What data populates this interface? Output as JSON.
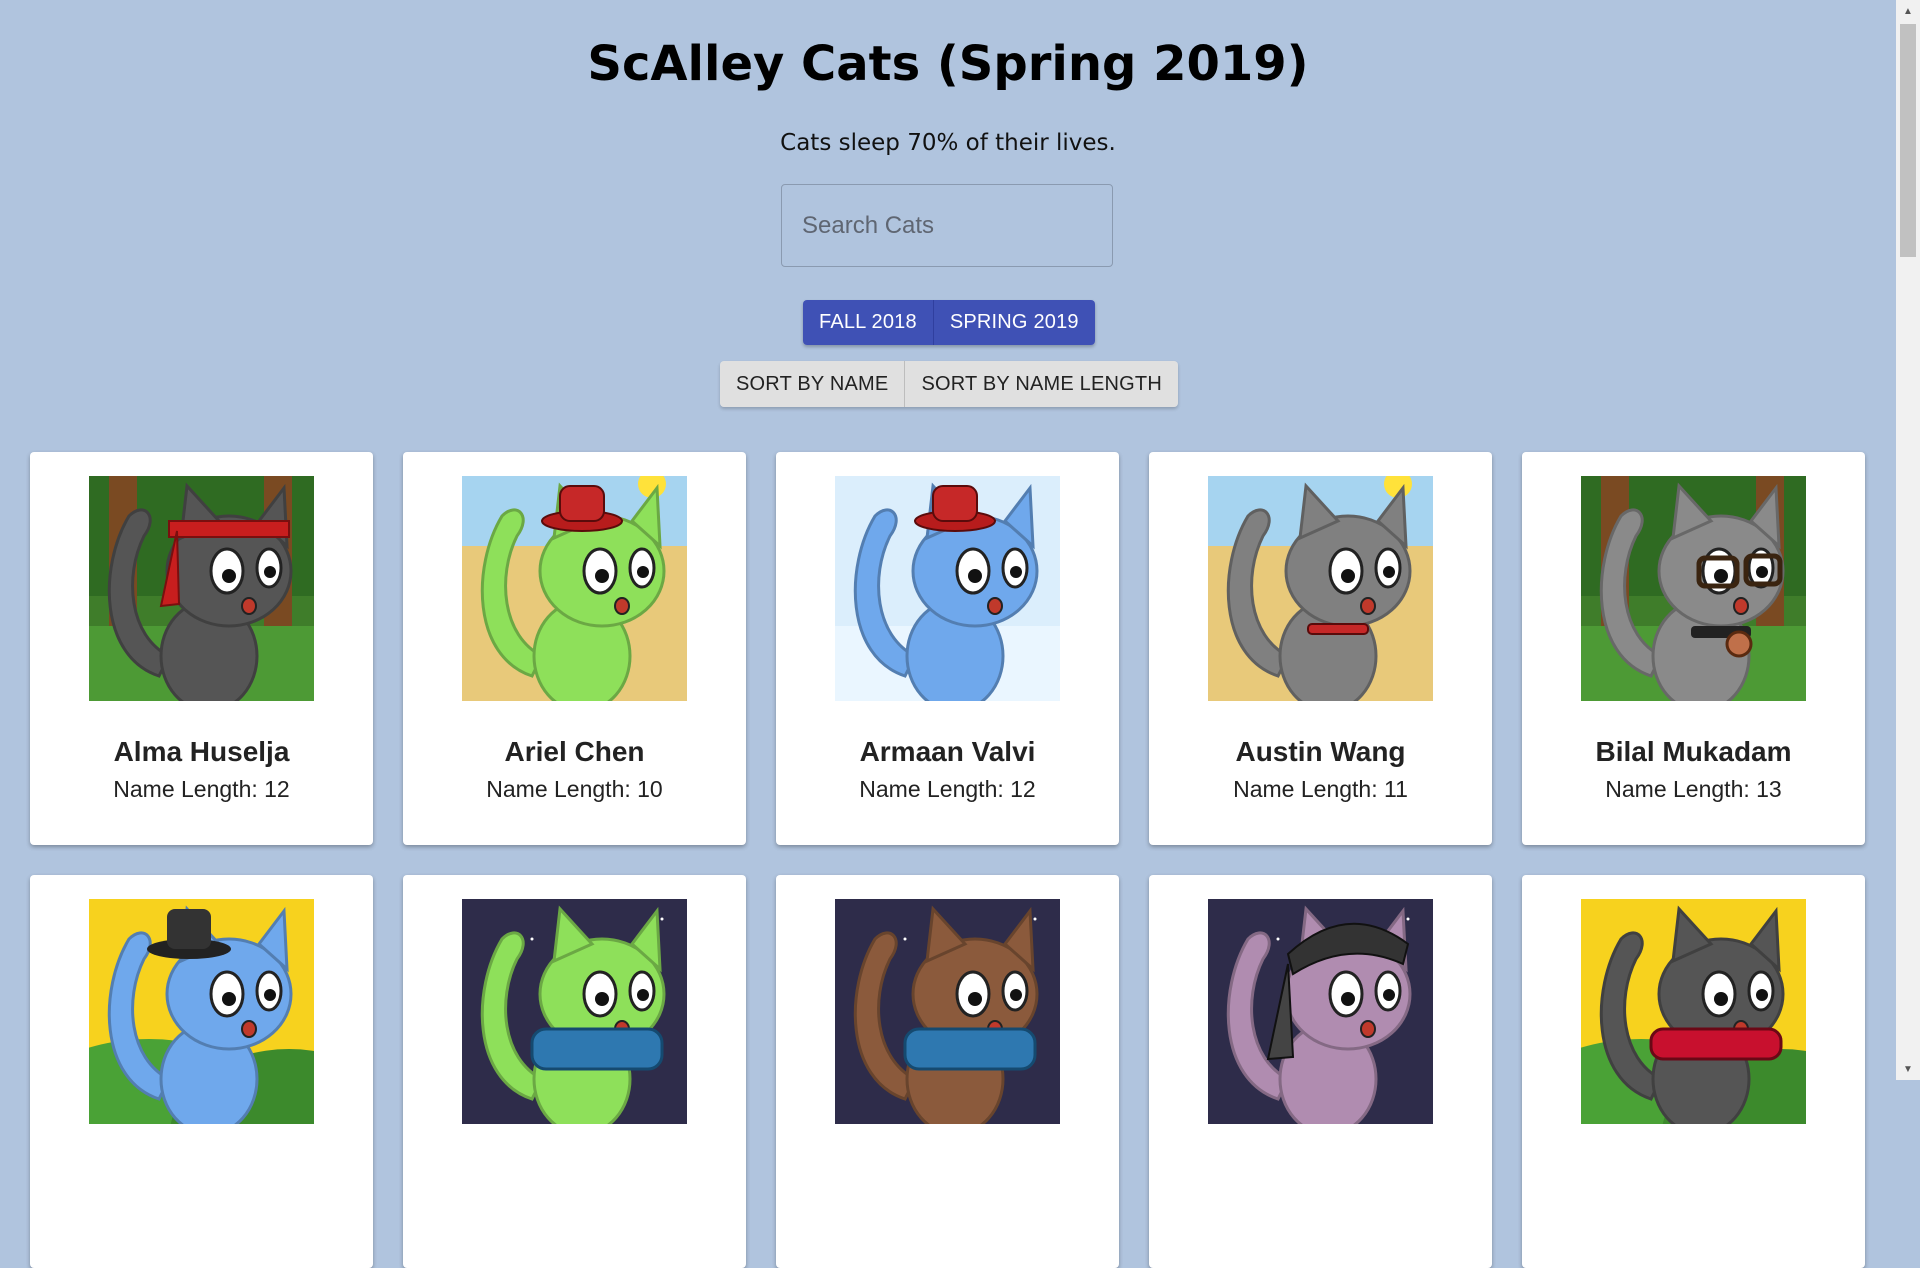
{
  "header": {
    "title": "ScAlley Cats (Spring 2019)",
    "fact": "Cats sleep 70% of their lives."
  },
  "search": {
    "placeholder": "Search Cats",
    "value": ""
  },
  "semester_buttons": [
    "FALL 2018",
    "SPRING 2019"
  ],
  "sort_buttons": [
    "SORT BY NAME",
    "SORT BY NAME LENGTH"
  ],
  "cats": [
    {
      "name": "Alma Huselja",
      "length_label": "Name Length: 12",
      "bg": "forest",
      "body": "#555555",
      "accessory": "headband"
    },
    {
      "name": "Ariel Chen",
      "length_label": "Name Length: 10",
      "bg": "desert",
      "body": "#8ee05a",
      "accessory": "red-hat"
    },
    {
      "name": "Armaan Valvi",
      "length_label": "Name Length: 12",
      "bg": "sky",
      "body": "#6fa8ec",
      "accessory": "red-hat"
    },
    {
      "name": "Austin Wang",
      "length_label": "Name Length: 11",
      "bg": "desert",
      "body": "#808080",
      "accessory": "collar"
    },
    {
      "name": "Bilal Mukadam",
      "length_label": "Name Length: 13",
      "bg": "forest",
      "body": "#8a8a8a",
      "accessory": "glasses"
    },
    {
      "name": "",
      "length_label": "",
      "bg": "yellow-hills",
      "body": "#6fa8ec",
      "accessory": "black-hat"
    },
    {
      "name": "",
      "length_label": "",
      "bg": "night",
      "body": "#8ee05a",
      "accessory": "scarf-blue"
    },
    {
      "name": "",
      "length_label": "",
      "bg": "night",
      "body": "#8b5a3c",
      "accessory": "scarf-blue"
    },
    {
      "name": "",
      "length_label": "",
      "bg": "night",
      "body": "#b08cb0",
      "accessory": "bandana"
    },
    {
      "name": "",
      "length_label": "",
      "bg": "yellow-hills",
      "body": "#555555",
      "accessory": "scarf-red"
    }
  ],
  "colors": {
    "page_bg": "#b0c4de",
    "primary_button": "#3f51b5",
    "secondary_button": "#e0e0e0"
  }
}
